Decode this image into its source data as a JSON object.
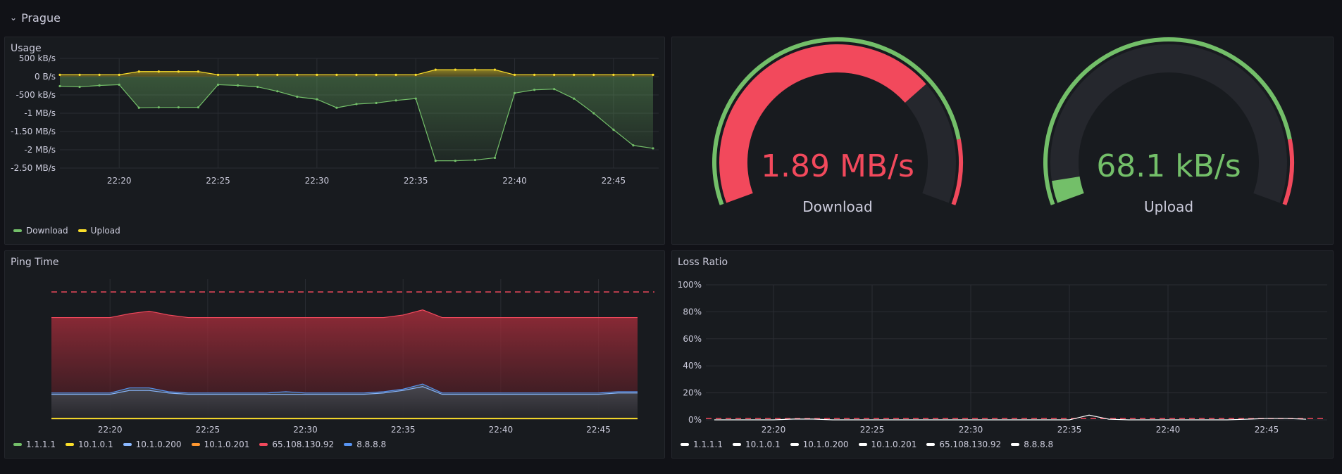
{
  "row": {
    "title": "Prague"
  },
  "panels": {
    "usage": {
      "title": "Usage",
      "legend": [
        {
          "label": "Download",
          "color": "#73bf69"
        },
        {
          "label": "Upload",
          "color": "#fade2a"
        }
      ]
    },
    "download": {
      "label": "Download",
      "value": "1.89 MB/s",
      "color": "#f2495c",
      "fraction": 0.72
    },
    "upload": {
      "label": "Upload",
      "value": "68.1 kB/s",
      "color": "#73bf69",
      "fraction": 0.05
    },
    "ping": {
      "title": "Ping Time",
      "legend": [
        {
          "label": "1.1.1.1",
          "color": "#73bf69"
        },
        {
          "label": "10.1.0.1",
          "color": "#fade2a"
        },
        {
          "label": "10.1.0.200",
          "color": "#8ab8ff"
        },
        {
          "label": "10.1.0.201",
          "color": "#ff9830"
        },
        {
          "label": "65.108.130.92",
          "color": "#f2495c"
        },
        {
          "label": "8.8.8.8",
          "color": "#5794f2"
        }
      ]
    },
    "loss": {
      "title": "Loss Ratio",
      "legend": [
        {
          "label": "1.1.1.1",
          "color": "#ffffff"
        },
        {
          "label": "10.1.0.1",
          "color": "#ffffff"
        },
        {
          "label": "10.1.0.200",
          "color": "#ffffff"
        },
        {
          "label": "10.1.0.201",
          "color": "#ffffff"
        },
        {
          "label": "65.108.130.92",
          "color": "#ffffff"
        },
        {
          "label": "8.8.8.8",
          "color": "#ffffff"
        }
      ]
    }
  },
  "chart_data": [
    {
      "type": "area",
      "title": "Usage",
      "x_ticks": [
        "22:20",
        "22:25",
        "22:30",
        "22:35",
        "22:40",
        "22:45"
      ],
      "x": [
        "22:17",
        "22:18",
        "22:19",
        "22:20",
        "22:21",
        "22:22",
        "22:23",
        "22:24",
        "22:25",
        "22:26",
        "22:27",
        "22:28",
        "22:29",
        "22:30",
        "22:31",
        "22:32",
        "22:33",
        "22:34",
        "22:35",
        "22:36",
        "22:37",
        "22:38",
        "22:39",
        "22:40",
        "22:41",
        "22:42",
        "22:43",
        "22:44",
        "22:45",
        "22:46",
        "22:47"
      ],
      "y_ticks": [
        "500 kB/s",
        "0 B/s",
        "-500 kB/s",
        "-1 MB/s",
        "-1.50 MB/s",
        "-2 MB/s",
        "-2.50 MB/s"
      ],
      "ylim": [
        -2.6,
        0.6
      ],
      "series": [
        {
          "name": "Download",
          "color": "#73bf69",
          "values": [
            -0.26,
            -0.28,
            -0.24,
            -0.22,
            -0.85,
            -0.84,
            -0.84,
            -0.84,
            -0.22,
            -0.24,
            -0.28,
            -0.4,
            -0.55,
            -0.62,
            -0.85,
            -0.75,
            -0.72,
            -0.65,
            -0.6,
            -2.3,
            -2.3,
            -2.28,
            -2.22,
            -0.45,
            -0.36,
            -0.34,
            -0.6,
            -1.0,
            -1.45,
            -1.88,
            -1.96
          ]
        },
        {
          "name": "Upload",
          "color": "#fade2a",
          "values": [
            0.05,
            0.05,
            0.05,
            0.05,
            0.14,
            0.14,
            0.14,
            0.14,
            0.05,
            0.05,
            0.05,
            0.05,
            0.05,
            0.05,
            0.05,
            0.05,
            0.05,
            0.05,
            0.05,
            0.19,
            0.19,
            0.19,
            0.19,
            0.05,
            0.05,
            0.05,
            0.05,
            0.05,
            0.05,
            0.05,
            0.05
          ]
        }
      ]
    },
    {
      "type": "area",
      "title": "Ping Time",
      "x_ticks": [
        "22:20",
        "22:25",
        "22:30",
        "22:35",
        "22:40",
        "22:45"
      ],
      "x": [
        "22:17",
        "22:18",
        "22:19",
        "22:20",
        "22:21",
        "22:22",
        "22:23",
        "22:24",
        "22:25",
        "22:26",
        "22:27",
        "22:28",
        "22:29",
        "22:30",
        "22:31",
        "22:32",
        "22:33",
        "22:34",
        "22:35",
        "22:36",
        "22:37",
        "22:38",
        "22:39",
        "22:40",
        "22:41",
        "22:42",
        "22:43",
        "22:44",
        "22:45",
        "22:46",
        "22:47"
      ],
      "threshold": 100,
      "ylim": [
        0,
        110
      ],
      "series": [
        {
          "name": "65.108.130.92",
          "color": "#f2495c",
          "values": [
            80,
            80,
            80,
            80,
            83,
            85,
            82,
            80,
            80,
            80,
            80,
            80,
            80,
            80,
            80,
            80,
            80,
            80,
            82,
            86,
            80,
            80,
            80,
            80,
            80,
            80,
            80,
            80,
            80,
            80,
            80
          ]
        },
        {
          "name": "8.8.8.8",
          "color": "#5794f2",
          "values": [
            21,
            21,
            21,
            21,
            25,
            25,
            22,
            21,
            21,
            21,
            21,
            21,
            22,
            21,
            21,
            21,
            21,
            22,
            24,
            28,
            21,
            21,
            21,
            21,
            21,
            21,
            21,
            21,
            21,
            22,
            22
          ]
        },
        {
          "name": "10.1.0.200",
          "color": "#8ab8ff",
          "values": [
            20,
            20,
            20,
            20,
            23,
            23,
            21,
            20,
            20,
            20,
            20,
            20,
            20,
            20,
            20,
            20,
            20,
            21,
            23,
            26,
            20,
            20,
            20,
            20,
            20,
            20,
            20,
            20,
            20,
            21,
            21
          ]
        },
        {
          "name": "10.1.0.1",
          "color": "#fade2a",
          "values": [
            1,
            1,
            1,
            1,
            1,
            1,
            1,
            1,
            1,
            1,
            1,
            1,
            1,
            1,
            1,
            1,
            1,
            1,
            1,
            1,
            1,
            1,
            1,
            1,
            1,
            1,
            1,
            1,
            1,
            1,
            1
          ]
        }
      ]
    },
    {
      "type": "line",
      "title": "Loss Ratio",
      "x_ticks": [
        "22:20",
        "22:25",
        "22:30",
        "22:35",
        "22:40",
        "22:45"
      ],
      "y_ticks": [
        "100%",
        "80%",
        "60%",
        "40%",
        "20%",
        "0%"
      ],
      "ylim": [
        0,
        100
      ],
      "threshold": 1,
      "x": [
        "22:17",
        "22:18",
        "22:19",
        "22:20",
        "22:21",
        "22:22",
        "22:23",
        "22:24",
        "22:25",
        "22:26",
        "22:27",
        "22:28",
        "22:29",
        "22:30",
        "22:31",
        "22:32",
        "22:33",
        "22:34",
        "22:35",
        "22:36",
        "22:37",
        "22:38",
        "22:39",
        "22:40",
        "22:41",
        "22:42",
        "22:43",
        "22:44",
        "22:45",
        "22:46",
        "22:47"
      ],
      "series": [
        {
          "name": "65.108.130.92",
          "color": "#ffffff",
          "values": [
            0,
            0,
            0,
            0,
            0.6,
            0.6,
            0,
            0,
            0,
            0,
            0,
            0,
            0,
            0,
            0,
            0,
            0,
            0,
            0,
            3.5,
            0.5,
            0,
            0,
            0,
            0,
            0,
            0,
            0.5,
            1,
            1,
            0.5
          ]
        }
      ]
    }
  ]
}
